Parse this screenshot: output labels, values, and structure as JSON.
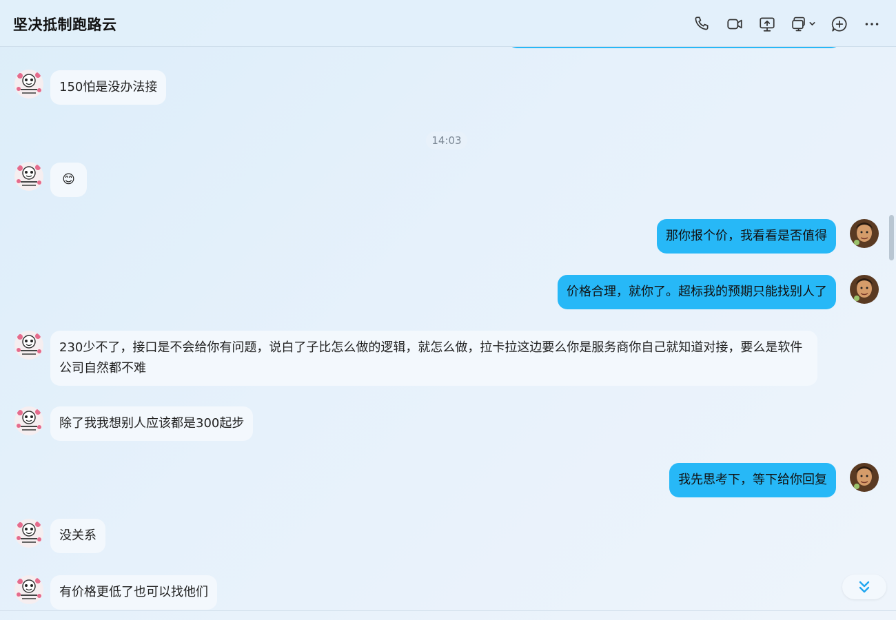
{
  "header": {
    "title": "坚决抵制跑路云",
    "icons": [
      "phone-icon",
      "video-icon",
      "screen-share-icon",
      "remote-assist-icon",
      "add-member-icon",
      "more-icon"
    ]
  },
  "timestamp": "14:03",
  "messages": [
    {
      "side": "in",
      "text": "150怕是没办法接"
    },
    {
      "side": "in",
      "text": "😊"
    },
    {
      "side": "out",
      "text": "那你报个价，我看看是否值得"
    },
    {
      "side": "out",
      "text": "价格合理，就你了。超标我的预期只能找别人了"
    },
    {
      "side": "in",
      "text": "230少不了，接口是不会给你有问题，说白了子比怎么做的逻辑，就怎么做，拉卡拉这边要么你是服务商你自己就知道对接，要么是软件公司自然都不难"
    },
    {
      "side": "in",
      "text": "除了我我想别人应该都是300起步"
    },
    {
      "side": "out",
      "text": "我先思考下，等下给你回复"
    },
    {
      "side": "in",
      "text": "没关系"
    },
    {
      "side": "in",
      "text": "有价格更低了也可以找他们"
    }
  ],
  "colors": {
    "outgoing_bubble": "#27b8f7",
    "incoming_bubble": "#f3f8fd",
    "background": "#e3f0fa"
  }
}
